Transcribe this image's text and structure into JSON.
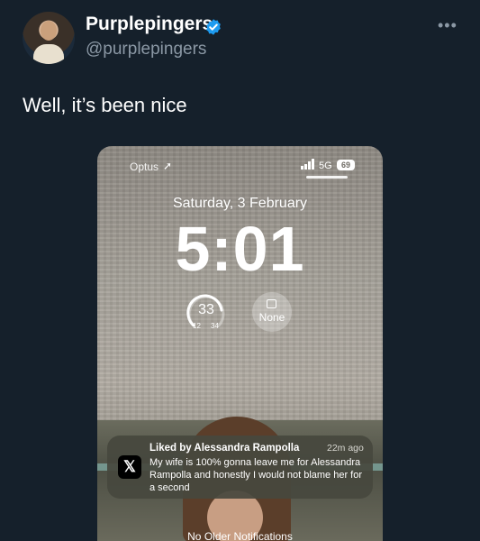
{
  "tweet": {
    "display_name": "Purplepingers",
    "handle": "@purplepingers",
    "text": "Well, it’s been nice",
    "more_label": "•••",
    "verified_icon": "verified-badge-icon",
    "verified_color": "#1d9bf0",
    "avatar_icon": "profile-avatar"
  },
  "lockscreen": {
    "carrier": "Optus",
    "network": "5G",
    "battery": "69",
    "date": "Saturday, 3 February",
    "time": "5:01",
    "weather": {
      "temp": "33",
      "low": "12",
      "high": "34"
    },
    "calendar_label": "None",
    "notification": {
      "app_icon": "x-logo-icon",
      "app_glyph": "𝕏",
      "title": "Liked by Alessandra Rampolla",
      "time": "22m ago",
      "body": "My wife is 100% gonna leave me for Alessandra Rampolla and honestly I would not blame her for a second"
    },
    "footer": "No Older Notifications"
  },
  "colors": {
    "background": "#15202b",
    "text_primary": "#ffffff",
    "text_secondary": "#8b98a5"
  }
}
